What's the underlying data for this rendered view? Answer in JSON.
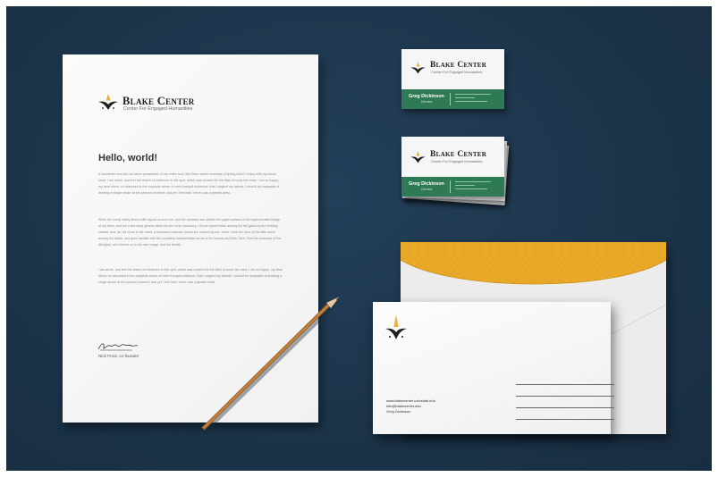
{
  "scene": {
    "background_color": "#1c354b",
    "accent_green": "#2e7a55",
    "accent_gold": "#e8b23a"
  },
  "brand": {
    "name": "Blake Center",
    "tagline": "Center For Engaged Humanities",
    "logo_icon": "star-bird-mark-icon"
  },
  "letterhead": {
    "greeting": "Hello, world!",
    "paragraphs": [
      "A wonderful serenity has taken possession of my entire soul, like these sweet mornings of spring which I enjoy with my whole heart. I am alone, and feel the charm of existence in this spot, which was created for the bliss of souls like mine. I am so happy, my dear friend, so absorbed in the exquisite sense of mere tranquil existence, that I neglect my talents. I should be incapable of drawing a single stroke at the present moment; and yet I feel that I never was a greater artist.",
      "While the lovely valley teems with vapour around me, and the meridian sun strikes the upper surface of the impenetrable foliage of my trees, and but a few stray gleams steal into the inner sanctuary, I throw myself down among the tall grass by the trickling stream; and, as I lie close to the earth, a thousand unknown plants are noticed by me: when I hear the buzz of the little world among the stalks, and grow familiar with the countless indescribable forms of the insects and flies, then I feel the presence of the Almighty, who formed us in his own image, and the breath.",
      "I am alone, and feel the charm of existence in this spot, which was created for the bliss of souls like mine. I am so happy, my dear friend, so absorbed in the exquisite sense of mere tranquil existence, that I neglect my talents. I should be incapable of drawing a single stroke at the present moment; and yet I feel that I never was a greater artist."
    ],
    "signature_name": "Nick Frost, co-founder"
  },
  "business_card": {
    "person_name": "Greg Dickinson",
    "person_title": "Director"
  },
  "envelope": {
    "address_lines": [
      "www.blakecenter.colostate.edu",
      "info@blakecenter.edu",
      "Greg Dickinson"
    ]
  }
}
